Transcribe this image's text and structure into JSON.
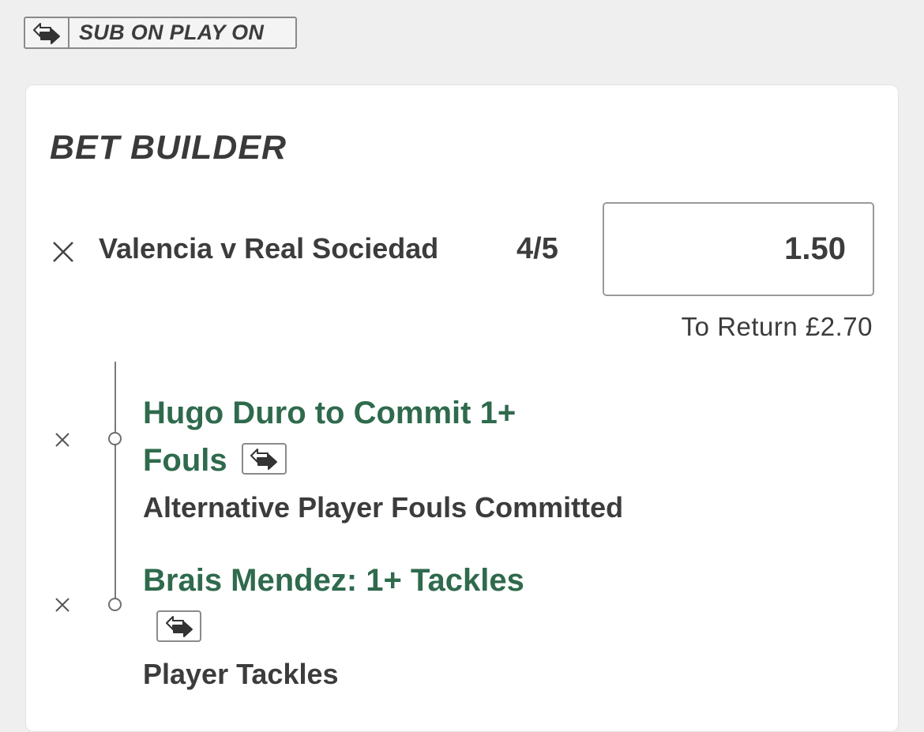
{
  "sub_badge": {
    "icon": "swap-icon",
    "label": "SUB ON PLAY ON"
  },
  "bet_builder": {
    "title": "BET BUILDER",
    "event": {
      "name": "Valencia v Real Sociedad",
      "odds": "4/5",
      "stake": "1.50",
      "to_return": "To Return £2.70"
    },
    "legs": [
      {
        "title_line1": "Hugo Duro to Commit 1+",
        "title_line2": "Fouls",
        "market": "Alternative Player Fouls Committed",
        "icon": "swap-icon"
      },
      {
        "title_line1": "Brais Mendez: 1+ Tackles",
        "market": "Player Tackles",
        "icon": "swap-icon"
      }
    ]
  },
  "colors": {
    "accent_green": "#2f6a4d",
    "text": "#3c3c3c",
    "background": "#efefef"
  }
}
